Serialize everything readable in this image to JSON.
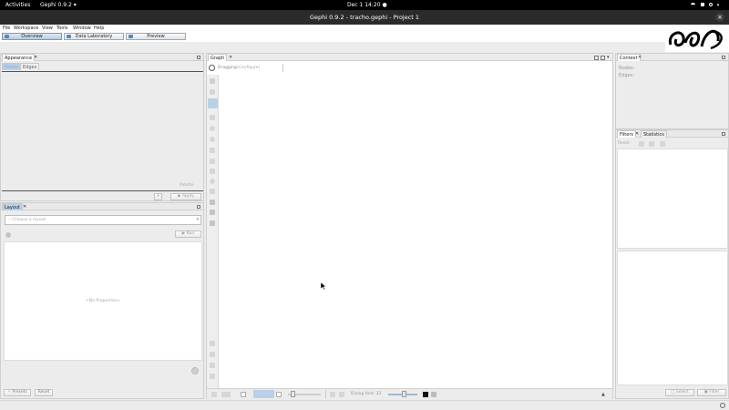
{
  "topbar": {
    "activities": "Activities",
    "app": "Gephi 0.9.2 ▾",
    "clock": "Dec 1  14:20 ●",
    "status_icons": "wifi sound power ▾"
  },
  "window": {
    "title": "Gephi 0.9.2 - tracho.gephi - Project 1",
    "close": "×"
  },
  "menu": {
    "items": [
      "File",
      "Workspace",
      "View",
      "Tools",
      "Window",
      "Help"
    ]
  },
  "toolbar": {
    "overview": "Overview",
    "data_lab": "Data Laboratory",
    "preview": "Preview"
  },
  "appearance": {
    "tab": "Appearance",
    "nodes": "Nodes",
    "edges": "Edges",
    "palette": "Palette",
    "apply": "Apply"
  },
  "layout": {
    "tab": "Layout",
    "choose": "---Choose a layout",
    "run": "Run",
    "no_properties": "<No Properties>",
    "presets": "Presets",
    "reset": "Reset"
  },
  "graph": {
    "tab": "Graph",
    "dragging": "Dragging",
    "configure": "(Configure)",
    "edge_weight_label": "Dialog font: 32"
  },
  "context": {
    "tab": "Context",
    "nodes_label": "Nodes:",
    "edges_label": "Edges:"
  },
  "filters": {
    "tab": "Filters",
    "statistics": "Statistics",
    "reset": "Reset",
    "select": "Select",
    "filter": "Filter"
  },
  "colors": {
    "accent": "#b9d0e6",
    "topbar": "#000000",
    "titlebar": "#2b2b2b"
  }
}
